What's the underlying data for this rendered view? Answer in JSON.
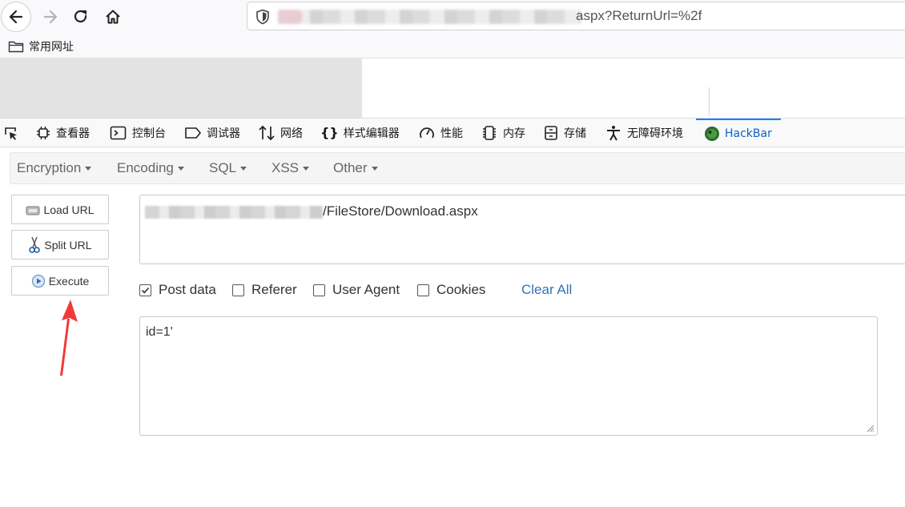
{
  "browser": {
    "nav": {
      "back_icon": "arrow-left-icon",
      "forward_icon": "arrow-right-icon",
      "reload_icon": "reload-icon",
      "home_icon": "home-icon"
    },
    "url_visible": "aspx?ReturnUrl=%2f",
    "bookmarks": [
      {
        "label": "常用网址",
        "icon": "folder-icon"
      }
    ]
  },
  "devtools": {
    "tabs": [
      {
        "label": "查看器",
        "icon": "inspector-icon"
      },
      {
        "label": "控制台",
        "icon": "console-icon"
      },
      {
        "label": "调试器",
        "icon": "debugger-icon"
      },
      {
        "label": "网络",
        "icon": "network-icon"
      },
      {
        "label": "样式编辑器",
        "icon": "style-editor-icon"
      },
      {
        "label": "性能",
        "icon": "performance-icon"
      },
      {
        "label": "内存",
        "icon": "memory-icon"
      },
      {
        "label": "存储",
        "icon": "storage-icon"
      },
      {
        "label": "无障碍环境",
        "icon": "accessibility-icon"
      },
      {
        "label": "HackBar",
        "icon": "hackbar-icon",
        "active": true
      }
    ]
  },
  "hackbar": {
    "menu": [
      "Encryption",
      "Encoding",
      "SQL",
      "XSS",
      "Other"
    ],
    "buttons": {
      "load_url": "Load URL",
      "split_url": "Split URL",
      "execute": "Execute"
    },
    "url_field_visible": "/FileStore/Download.aspx",
    "options": [
      {
        "label": "Post data",
        "checked": true
      },
      {
        "label": "Referer",
        "checked": false
      },
      {
        "label": "User Agent",
        "checked": false
      },
      {
        "label": "Cookies",
        "checked": false
      }
    ],
    "clear_all": "Clear All",
    "post_data": "id=1'"
  },
  "colors": {
    "accent_blue": "#0a84ff",
    "link_blue": "#2f73b8",
    "arrow_red": "#f03a3a"
  }
}
